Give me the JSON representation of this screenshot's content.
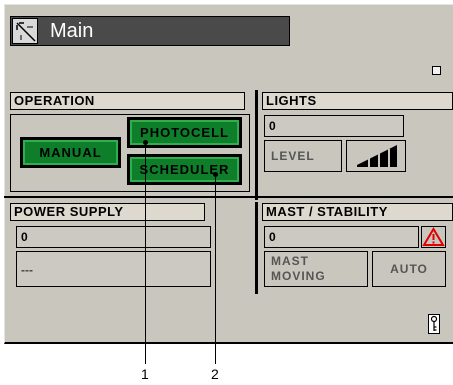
{
  "window": {
    "title": "Main"
  },
  "operation": {
    "header": "OPERATION",
    "manual_label": "MANUAL",
    "photocell_label": "PHOTOCELL",
    "scheduler_label": "SCHEDULER"
  },
  "lights": {
    "header": "LIGHTS",
    "value": "0",
    "level_label": "LEVEL"
  },
  "power_supply": {
    "header": "POWER SUPPLY",
    "value": "0",
    "status": "---"
  },
  "mast": {
    "header": "MAST / STABILITY",
    "value": "0",
    "moving_label_line1": "MAST",
    "moving_label_line2": "MOVING",
    "auto_label": "AUTO"
  },
  "callouts": [
    "1",
    "2"
  ],
  "icons": {
    "window_icon": "window-icon",
    "warning": "warning-icon",
    "level_bars": "level-bars-icon",
    "key": "key-icon"
  },
  "colors": {
    "panel": "#c9c6be",
    "green_button": "#0f7e2a",
    "warning": "#e00000",
    "titlebar": "#4a4a4a"
  }
}
